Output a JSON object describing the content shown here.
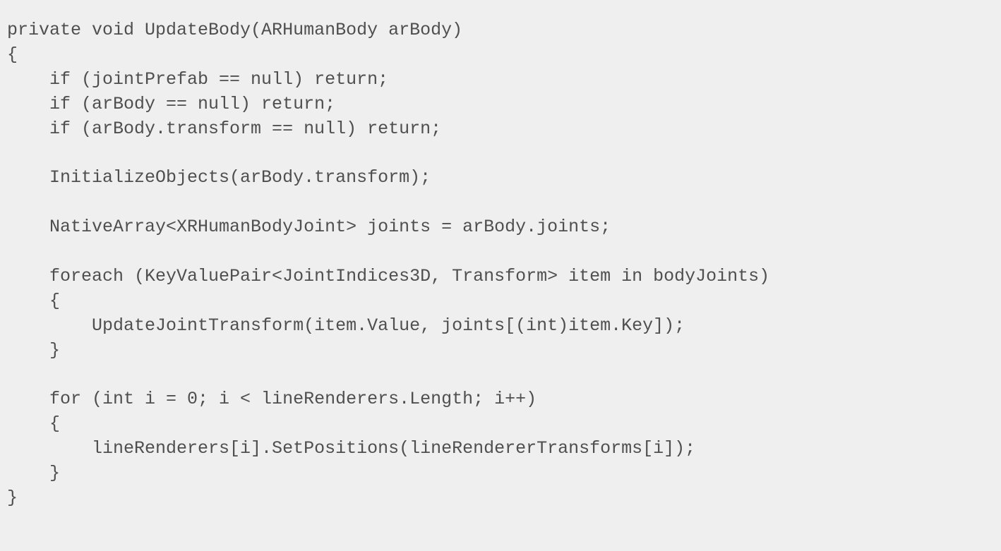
{
  "code": {
    "lines": [
      "private void UpdateBody(ARHumanBody arBody)",
      "{",
      "    if (jointPrefab == null) return;",
      "    if (arBody == null) return;",
      "    if (arBody.transform == null) return;",
      "",
      "    InitializeObjects(arBody.transform);",
      "",
      "    NativeArray<XRHumanBodyJoint> joints = arBody.joints;",
      "",
      "    foreach (KeyValuePair<JointIndices3D, Transform> item in bodyJoints)",
      "    {",
      "        UpdateJointTransform(item.Value, joints[(int)item.Key]);",
      "    }",
      "",
      "    for (int i = 0; i < lineRenderers.Length; i++)",
      "    {",
      "        lineRenderers[i].SetPositions(lineRendererTransforms[i]);",
      "    }",
      "}"
    ]
  }
}
